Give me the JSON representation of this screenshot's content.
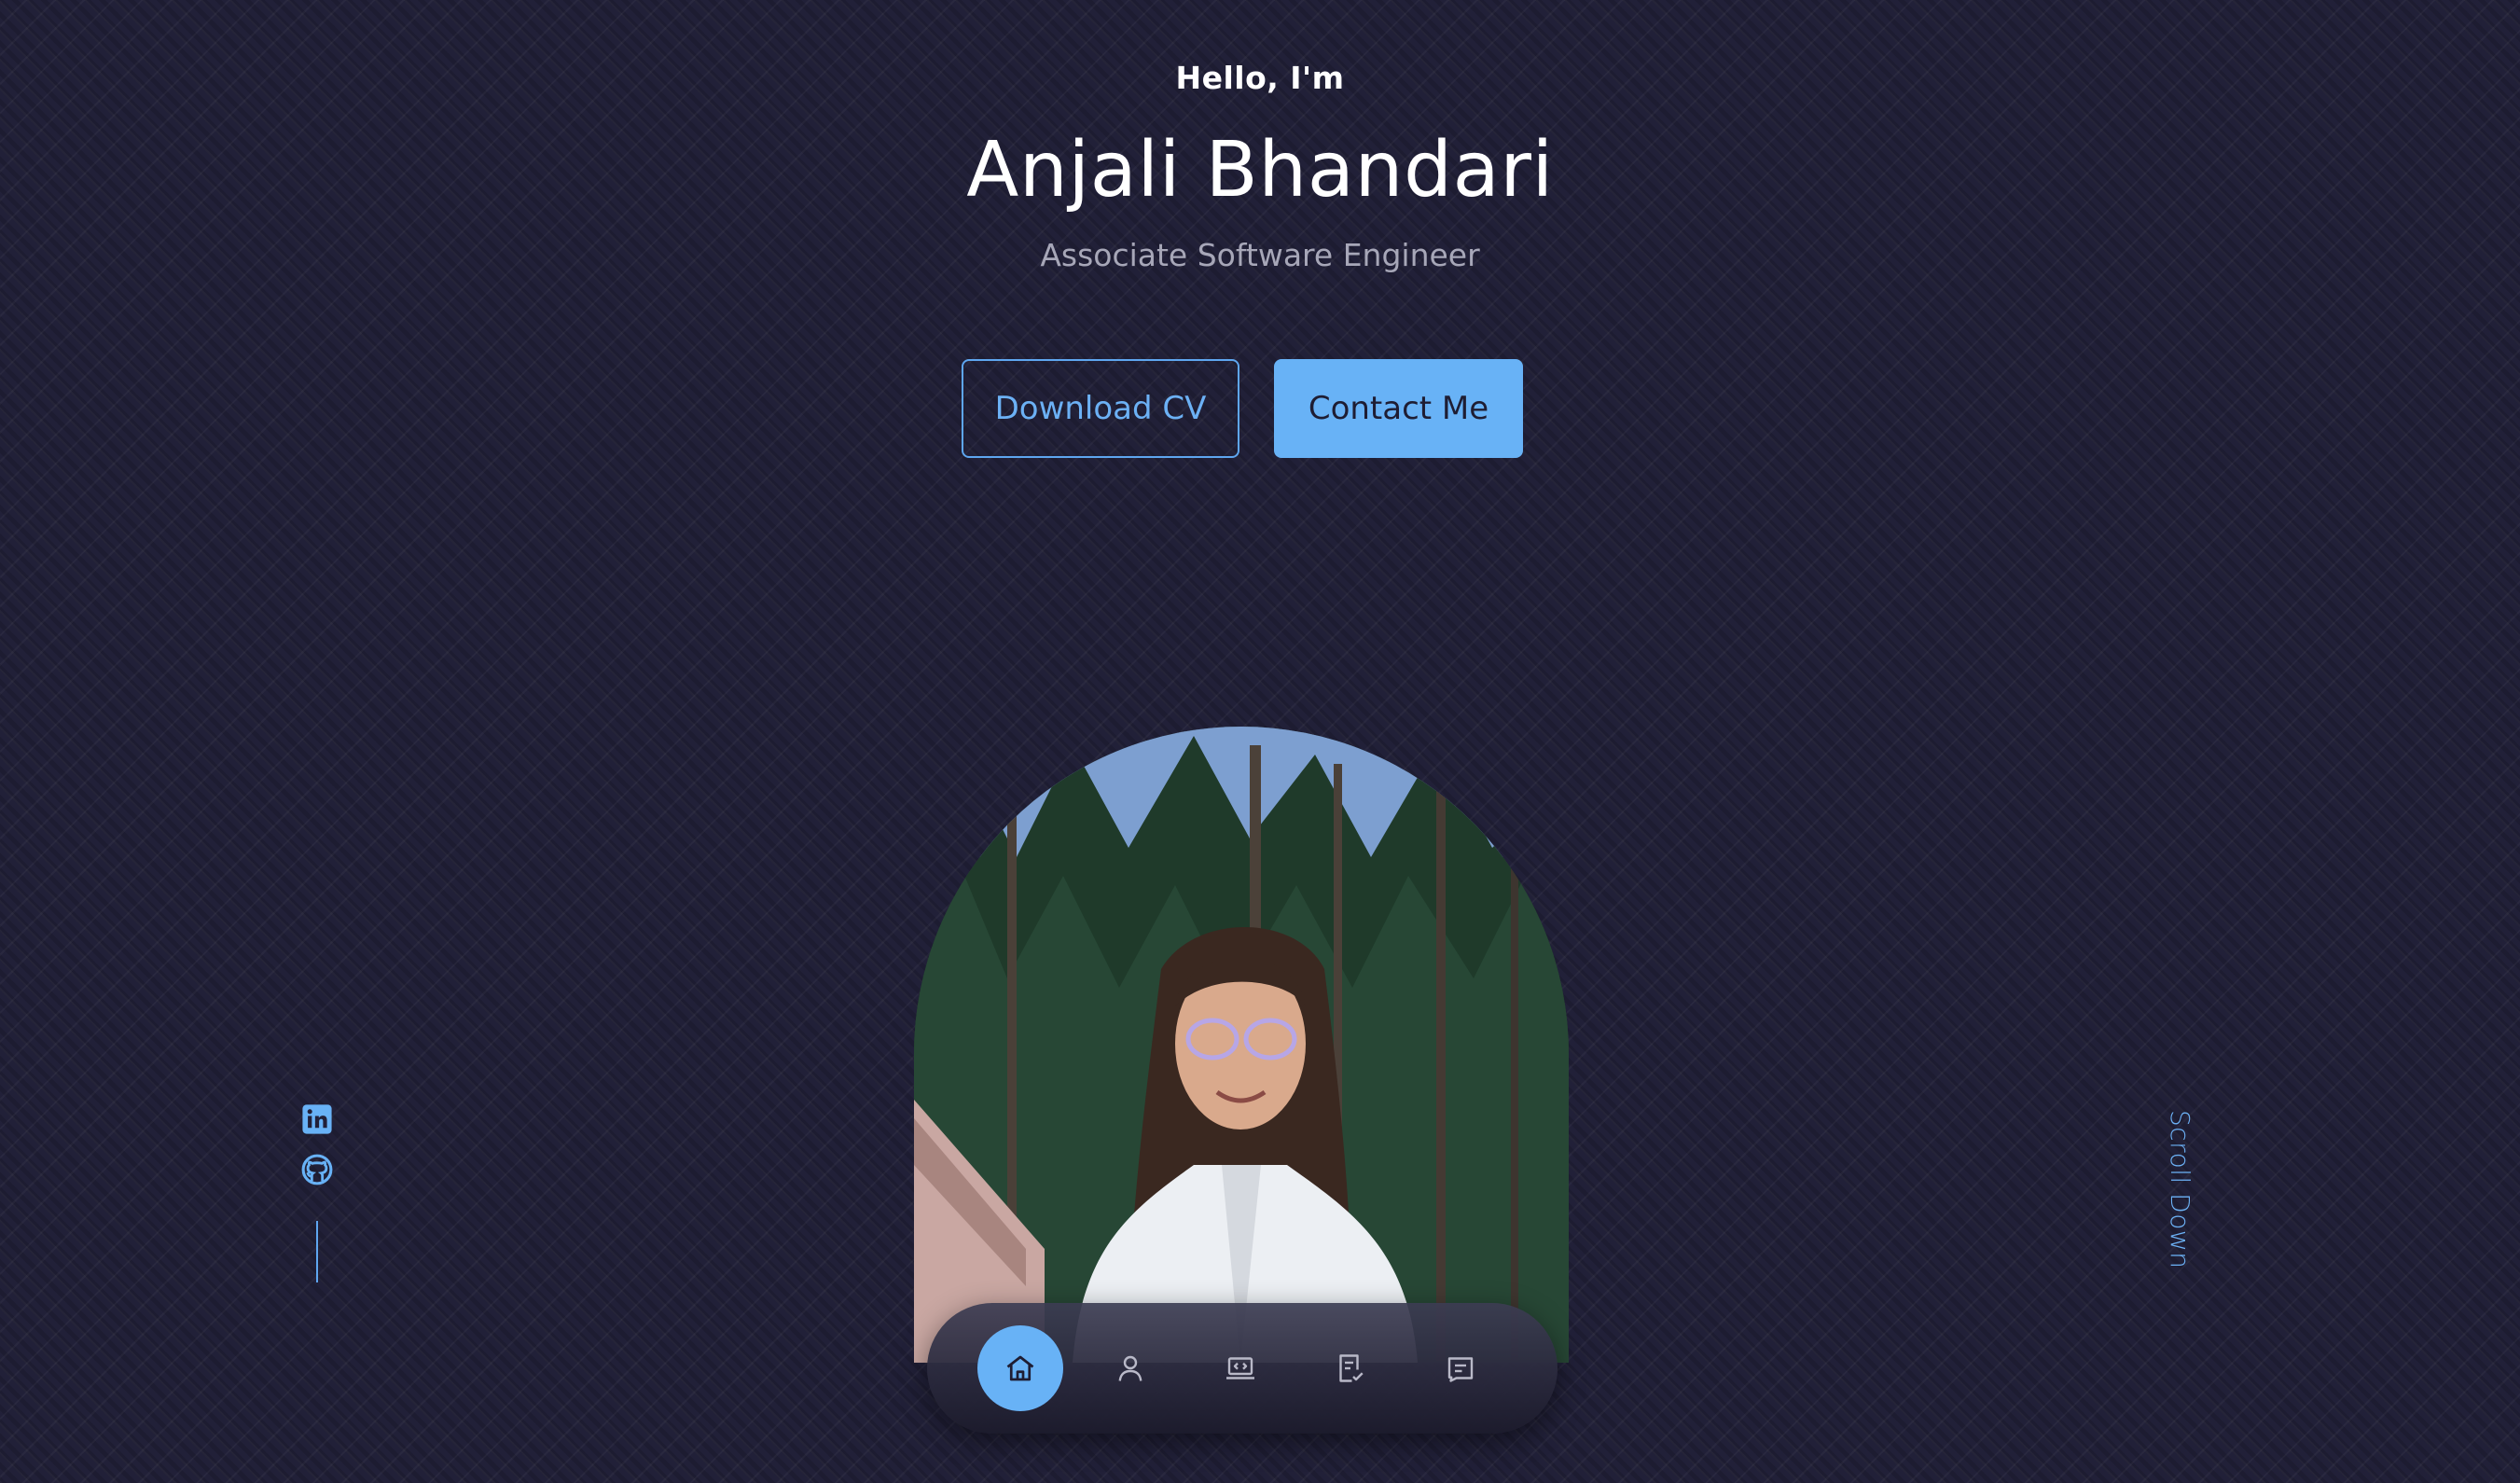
{
  "hero": {
    "greeting": "Hello, I'm",
    "name": "Anjali Bhandari",
    "role": "Associate Software Engineer"
  },
  "buttons": {
    "download_cv": "Download CV",
    "contact_me": "Contact Me"
  },
  "photo": {
    "alt": "Portrait photo"
  },
  "nav": {
    "items": [
      {
        "icon": "home-icon",
        "active": true
      },
      {
        "icon": "user-icon",
        "active": false
      },
      {
        "icon": "laptop-code-icon",
        "active": false
      },
      {
        "icon": "document-check-icon",
        "active": false
      },
      {
        "icon": "message-icon",
        "active": false
      }
    ]
  },
  "social": {
    "items": [
      {
        "icon": "linkedin-icon"
      },
      {
        "icon": "github-icon"
      }
    ]
  },
  "scroll": {
    "label": "Scroll Down"
  },
  "colors": {
    "background": "#212038",
    "accent": "#68b2f6",
    "text": "#ffffff",
    "muted_text": "#a7a7b8"
  }
}
